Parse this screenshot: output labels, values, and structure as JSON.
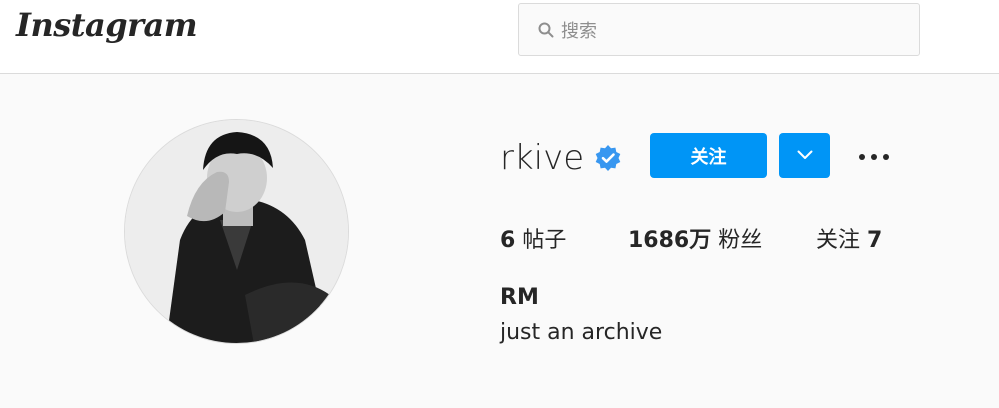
{
  "header": {
    "logo_text": "Instagram",
    "search": {
      "placeholder": "搜索"
    }
  },
  "profile": {
    "username": "rkive",
    "verified": true,
    "follow_label": "关注",
    "stats": {
      "posts_count": "6",
      "posts_label": "帖子",
      "followers_count": "1686万",
      "followers_label": "粉丝",
      "following_label": "关注",
      "following_count": "7"
    },
    "full_name": "RM",
    "bio": "just an archive"
  },
  "icons": {
    "search": "search-icon",
    "verified": "verified-badge-icon",
    "dropdown": "chevron-down-icon",
    "more": "more-options-icon"
  },
  "colors": {
    "primary_button": "#0095f6",
    "verified_badge": "#3897f0",
    "background": "#fafafa",
    "border": "#dbdbdb"
  }
}
